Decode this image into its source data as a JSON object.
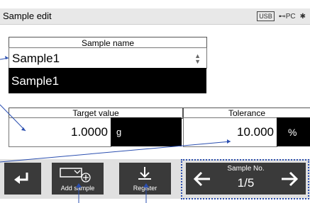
{
  "titlebar": {
    "title": "Sample edit",
    "usb": "USB",
    "pc": "PC"
  },
  "sample_name": {
    "label": "Sample name",
    "value": "Sample1",
    "selected": "Sample1"
  },
  "target": {
    "label": "Target value",
    "value": "1.0000",
    "unit": "g"
  },
  "tolerance": {
    "label": "Tolerance",
    "value": "10.000",
    "unit": "%"
  },
  "toolbar": {
    "add_label": "Add sample",
    "register_label": "Register",
    "sample_no_label": "Sample No.",
    "sample_no_value": "1/5"
  },
  "colors": {
    "accent": "#2b4fb0",
    "button": "#3a3a3a",
    "toolbar": "#e0e0e0"
  }
}
